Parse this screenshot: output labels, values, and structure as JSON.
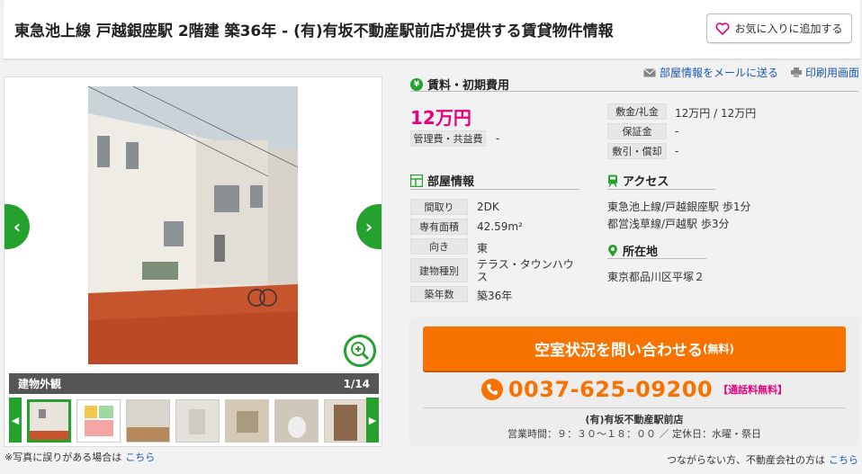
{
  "header": {
    "title": "東急池上線 戸越銀座駅 2階建 築36年 - (有)有坂不動産駅前店が提供する賃貸物件情報",
    "favorite_label": "お気に入りに追加する"
  },
  "gallery": {
    "caption": "建物外観",
    "counter": "1/14",
    "note": "※写真に誤りがある場合は",
    "note_link": "こちら"
  },
  "links": {
    "email": "部屋情報をメールに送る",
    "print": "印刷用画面"
  },
  "rent_section": {
    "heading": "賃料・初期費用",
    "rent": "12万円",
    "mgmt_label": "管理費・共益費",
    "mgmt_value": "-",
    "deposit_label": "敷金/礼金",
    "deposit_value": "12万円 / 12万円",
    "guarantee_label": "保証金",
    "guarantee_value": "-",
    "amort_label": "敷引・償却",
    "amort_value": "-"
  },
  "room_section": {
    "heading": "部屋情報",
    "rows": [
      {
        "label": "間取り",
        "value": "2DK"
      },
      {
        "label": "専有面積",
        "value": "42.59m²"
      },
      {
        "label": "向き",
        "value": "東"
      },
      {
        "label": "建物種別",
        "value": "テラス・タウンハウス"
      },
      {
        "label": "築年数",
        "value": "築36年"
      }
    ]
  },
  "access_section": {
    "heading": "アクセス",
    "lines": [
      "東急池上線/戸越銀座駅 歩1分",
      "都営浅草線/戸越駅 歩3分"
    ]
  },
  "location_section": {
    "heading": "所在地",
    "address": "東京都品川区平塚２"
  },
  "contact": {
    "cta_label": "空室状況を問い合わせる",
    "cta_suffix": "(無料)",
    "phone": "0037-625-09200",
    "phone_free": "【通話料無料】",
    "agency": "(有)有坂不動産駅前店",
    "hours": "営業時間：９：３０～１８：００ ／ 定休日：水曜・祭日"
  },
  "footer": {
    "note": "つながらない方、不動産会社の方は",
    "note_link": "こちら"
  },
  "colors": {
    "accent_green": "#25a12d",
    "rent_pink": "#e6007e",
    "cta_orange": "#f87200"
  }
}
